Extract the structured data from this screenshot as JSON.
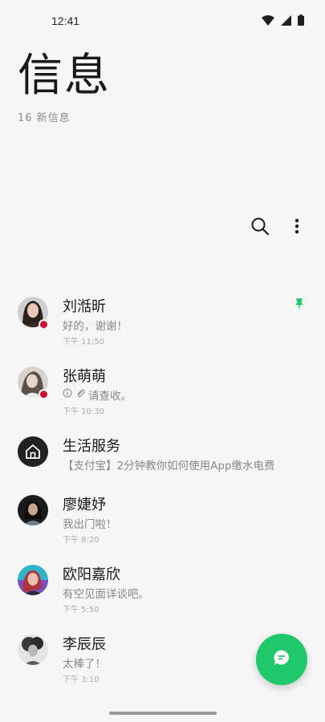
{
  "status_bar": {
    "time": "12:41",
    "icons": [
      "wifi-icon",
      "cellular-signal-icon",
      "battery-icon"
    ]
  },
  "header": {
    "title": "信息",
    "subtitle": "16 新信息"
  },
  "toolbar": {
    "icons": [
      "search-icon",
      "more-vertical-icon"
    ]
  },
  "colors": {
    "accent": "#1ec86b",
    "unread_dot": "#c8102e",
    "background": "#f6f6f6"
  },
  "conversations": [
    {
      "name": "刘湉昕",
      "preview": "好的，谢谢！",
      "time": "下午 11:50",
      "unread": true,
      "pinned": true,
      "avatar": "photo"
    },
    {
      "name": "张萌萌",
      "preview": "请查收。",
      "time": "下午 10:30",
      "unread": true,
      "pinned": false,
      "avatar": "photo",
      "preview_icons": [
        "info-icon",
        "attachment-icon"
      ]
    },
    {
      "name": "生活服务",
      "preview": "【支付宝】2分钟教你如何使用App缴水电费",
      "time": "",
      "unread": false,
      "pinned": false,
      "avatar": "home-icon"
    },
    {
      "name": "廖婕妤",
      "preview": "我出门啦！",
      "time": "下午 8:20",
      "unread": false,
      "pinned": false,
      "avatar": "photo"
    },
    {
      "name": "欧阳嘉欣",
      "preview": "有空见面详谈吧。",
      "time": "下午 5:50",
      "unread": false,
      "pinned": false,
      "avatar": "photo"
    },
    {
      "name": "李辰辰",
      "preview": "太棒了！",
      "time": "下午 3:10",
      "unread": false,
      "pinned": false,
      "avatar": "photo"
    }
  ],
  "fab": {
    "icon": "new-message-icon"
  }
}
